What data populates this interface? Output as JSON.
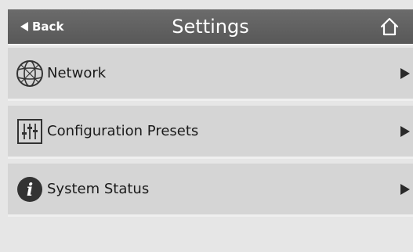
{
  "header": {
    "back_label": "Back",
    "title": "Settings"
  },
  "menu": {
    "items": [
      {
        "label": "Network",
        "icon": "globe-icon"
      },
      {
        "label": "Configuration Presets",
        "icon": "sliders-icon"
      },
      {
        "label": "System Status",
        "icon": "info-icon"
      }
    ]
  },
  "colors": {
    "header_bg": "#5e5e5e",
    "item_bg": "#d5d5d5",
    "page_bg": "#e6e6e6"
  }
}
